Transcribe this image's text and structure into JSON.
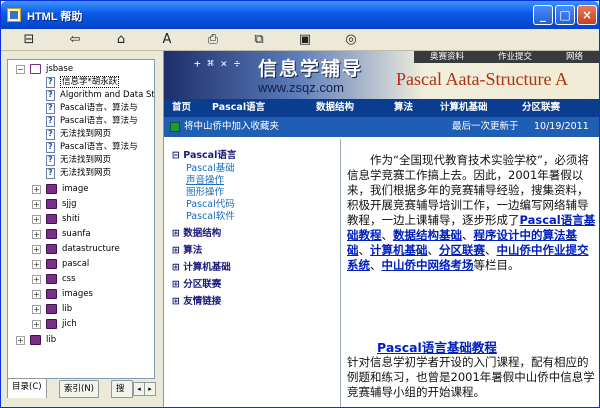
{
  "window": {
    "title": "HTML 帮助",
    "min_label": "_",
    "max_label": "□",
    "close_label": "×"
  },
  "toolbar": {
    "icons": [
      "hide-icon",
      "back-icon",
      "home-icon",
      "font-icon",
      "print-icon",
      "options-icon",
      "contents-icon",
      "web-icon"
    ]
  },
  "tree": {
    "root": "jsbase",
    "pages": [
      "信息学*胡永跃",
      "Algorithm and Data St",
      "Pascal语言、算法与",
      "Pascal语言、算法与",
      "无法找到网页",
      "Pascal语言、算法与",
      "无法找到网页",
      "无法找到网页"
    ],
    "books": [
      "image",
      "sjjg",
      "shiti",
      "suanfa",
      "datastructure",
      "pascal",
      "css",
      "images",
      "lib",
      "jich"
    ],
    "bottom": "lib"
  },
  "tabs": {
    "contents": "目录(C)",
    "index": "索引(N)",
    "search": "搜"
  },
  "banner": {
    "symbols": "+ ⌘ × ÷",
    "logo": "信息学辅导",
    "url": "www.zsqz.com",
    "subtitle": "Pascal Aata-Structure A",
    "topnav": [
      "奥赛资料",
      "作业提交",
      "网络"
    ]
  },
  "menubar": [
    "首页",
    "Pascal语言",
    "数据结构",
    "算法",
    "计算机基础",
    "分区联赛"
  ],
  "addbar": {
    "add_favorite": "将中山侨中加入收藏夹",
    "updated_label": "最后一次更新于",
    "updated_date": "10/19/2011"
  },
  "leftmenu": {
    "items": [
      "Pascal语言",
      "数据结构",
      "算法",
      "计算机基础",
      "分区联赛",
      "友情链接"
    ],
    "pascal_subs": [
      "Pascal基础",
      "声音操作",
      "图形操作",
      "Pascal代码",
      "Pascal软件"
    ]
  },
  "article": {
    "intro_a": "作为“全国现代教育技术实验学校”，必须将信息学竞赛工作搞上去。因此，2001年暑假以来，我们根据多年的竞赛辅导经验，搜集资料，积极开展竞赛辅导培训工作，一边编写网络辅导教程，一边上课辅导，逐步形成了",
    "link1": "Pascal语言基础教程",
    "link2": "数据结构基础",
    "link3": "程序设计中的算法基础",
    "link4": "计算机基础",
    "link5": "分区联赛",
    "link6": "中山侨中作业提交系统",
    "link7": "中山侨中网络考场",
    "intro_b": "等栏目。",
    "section_title": "Pascal语言基础教程",
    "section_body": "针对信息学初学者开设的入门课程，配有相应的例题和练习，也曾是2001年暑假中山侨中信息学竞赛辅导小组的开始课程。"
  }
}
